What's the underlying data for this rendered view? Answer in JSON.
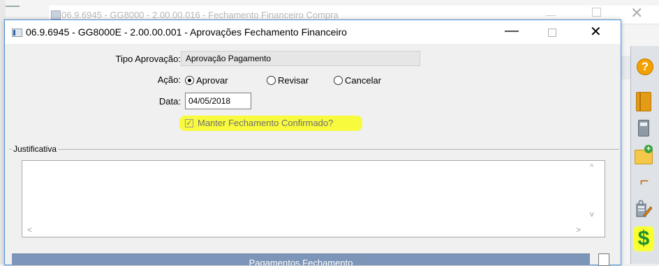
{
  "background_window": {
    "title": "06.9.6945 - GG8000 - 2.00.00.016 - Fechamento Financeiro Compra"
  },
  "dialog": {
    "title": "06.9.6945 - GG8000E - 2.00.00.001 - Aprovações Fechamento Financeiro",
    "minimize_glyph": "—",
    "close_glyph": "✕"
  },
  "form": {
    "tipo_label": "Tipo Aprovação:",
    "tipo_value": "Aprovação Pagamento",
    "acao_label": "Ação:",
    "acao_options": [
      {
        "label": "Aprovar",
        "selected": true
      },
      {
        "label": "Revisar",
        "selected": false
      },
      {
        "label": "Cancelar",
        "selected": false
      }
    ],
    "data_label": "Data:",
    "data_value": "04/05/2018",
    "manter_label": "Manter Fechamento Confirmado?",
    "manter_checked": true
  },
  "justificativa": {
    "label": "Justificativa",
    "value": ""
  },
  "bottom_bar": {
    "label": "Pagamentos Fechamento"
  },
  "toolbar_icons": [
    "help-icon",
    "book-icon",
    "calculator-icon",
    "add-folder-icon",
    "gun-icon",
    "report-icon",
    "dollar-icon"
  ],
  "colors": {
    "highlight": "#f8fb2e",
    "bottom_bar": "#7d95b8",
    "dialog_border": "#4a90d9"
  }
}
